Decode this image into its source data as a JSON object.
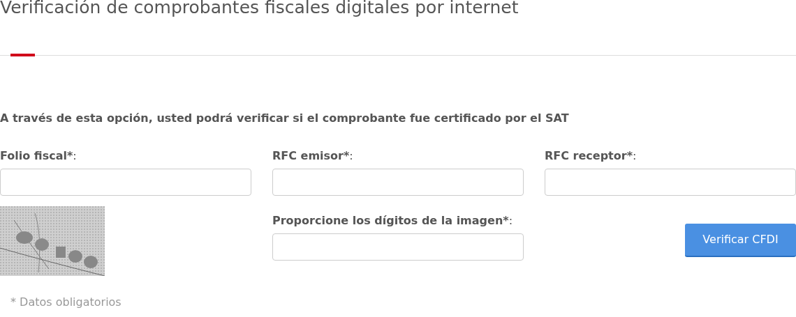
{
  "title": "Verificación de comprobantes fiscales digitales por internet",
  "description": "A través de esta opción, usted podrá verificar si el comprobante fue certificado por el SAT",
  "fields": [
    {
      "label": "Folio fiscal*",
      "suffix": ":"
    },
    {
      "label": "RFC emisor*",
      "suffix": ":"
    },
    {
      "label": "RFC receptor*",
      "suffix": ":"
    }
  ],
  "captcha_field": {
    "label": "Proporcione los dígitos de la imagen*",
    "suffix": ":"
  },
  "submit_button": "Verificar CFDI",
  "footnote": "* Datos obligatorios"
}
